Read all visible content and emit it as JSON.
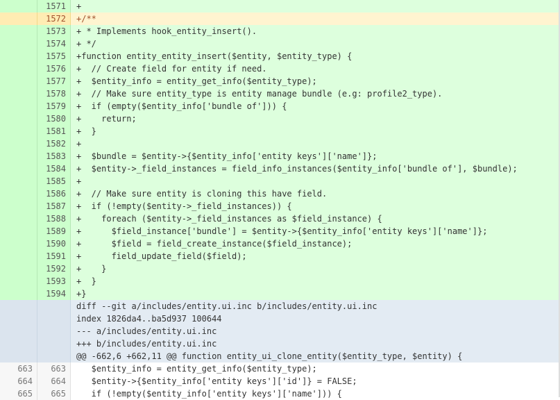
{
  "diff": {
    "lines": [
      {
        "type": "add",
        "old": "",
        "new": "1571",
        "text": "+"
      },
      {
        "type": "hl",
        "old": "",
        "new": "1572",
        "text": "+/**"
      },
      {
        "type": "add",
        "old": "",
        "new": "1573",
        "text": "+ * Implements hook_entity_insert()."
      },
      {
        "type": "add",
        "old": "",
        "new": "1574",
        "text": "+ */"
      },
      {
        "type": "add",
        "old": "",
        "new": "1575",
        "text": "+function entity_entity_insert($entity, $entity_type) {"
      },
      {
        "type": "add",
        "old": "",
        "new": "1576",
        "text": "+  // Create field for entity if need."
      },
      {
        "type": "add",
        "old": "",
        "new": "1577",
        "text": "+  $entity_info = entity_get_info($entity_type);"
      },
      {
        "type": "add",
        "old": "",
        "new": "1578",
        "text": "+  // Make sure entity_type is entity manage bundle (e.g: profile2_type)."
      },
      {
        "type": "add",
        "old": "",
        "new": "1579",
        "text": "+  if (empty($entity_info['bundle of'])) {"
      },
      {
        "type": "add",
        "old": "",
        "new": "1580",
        "text": "+    return;"
      },
      {
        "type": "add",
        "old": "",
        "new": "1581",
        "text": "+  }"
      },
      {
        "type": "add",
        "old": "",
        "new": "1582",
        "text": "+"
      },
      {
        "type": "add",
        "old": "",
        "new": "1583",
        "text": "+  $bundle = $entity->{$entity_info['entity keys']['name']};"
      },
      {
        "type": "add",
        "old": "",
        "new": "1584",
        "text": "+  $entity->_field_instances = field_info_instances($entity_info['bundle of'], $bundle);"
      },
      {
        "type": "add",
        "old": "",
        "new": "1585",
        "text": "+"
      },
      {
        "type": "add",
        "old": "",
        "new": "1586",
        "text": "+  // Make sure entity is cloning this have field."
      },
      {
        "type": "add",
        "old": "",
        "new": "1587",
        "text": "+  if (!empty($entity->_field_instances)) {"
      },
      {
        "type": "add",
        "old": "",
        "new": "1588",
        "text": "+    foreach ($entity->_field_instances as $field_instance) {"
      },
      {
        "type": "add",
        "old": "",
        "new": "1589",
        "text": "+      $field_instance['bundle'] = $entity->{$entity_info['entity keys']['name']};"
      },
      {
        "type": "add",
        "old": "",
        "new": "1590",
        "text": "+      $field = field_create_instance($field_instance);"
      },
      {
        "type": "add",
        "old": "",
        "new": "1591",
        "text": "+      field_update_field($field);"
      },
      {
        "type": "add",
        "old": "",
        "new": "1592",
        "text": "+    }"
      },
      {
        "type": "add",
        "old": "",
        "new": "1593",
        "text": "+  }"
      },
      {
        "type": "add",
        "old": "",
        "new": "1594",
        "text": "+}"
      },
      {
        "type": "meta",
        "old": "",
        "new": "",
        "text": "diff --git a/includes/entity.ui.inc b/includes/entity.ui.inc"
      },
      {
        "type": "meta",
        "old": "",
        "new": "",
        "text": "index 1826da4..ba5d937 100644"
      },
      {
        "type": "meta",
        "old": "",
        "new": "",
        "text": "--- a/includes/entity.ui.inc"
      },
      {
        "type": "meta",
        "old": "",
        "new": "",
        "text": "+++ b/includes/entity.ui.inc"
      },
      {
        "type": "meta",
        "old": "",
        "new": "",
        "text": "@@ -662,6 +662,11 @@ function entity_ui_clone_entity($entity_type, $entity) {"
      },
      {
        "type": "ctx",
        "old": "663",
        "new": "663",
        "text": "   $entity_info = entity_get_info($entity_type);"
      },
      {
        "type": "ctx",
        "old": "664",
        "new": "664",
        "text": "   $entity->{$entity_info['entity keys']['id']} = FALSE;"
      },
      {
        "type": "ctx",
        "old": "665",
        "new": "665",
        "text": "   if (!empty($entity_info['entity keys']['name'])) {"
      }
    ]
  }
}
